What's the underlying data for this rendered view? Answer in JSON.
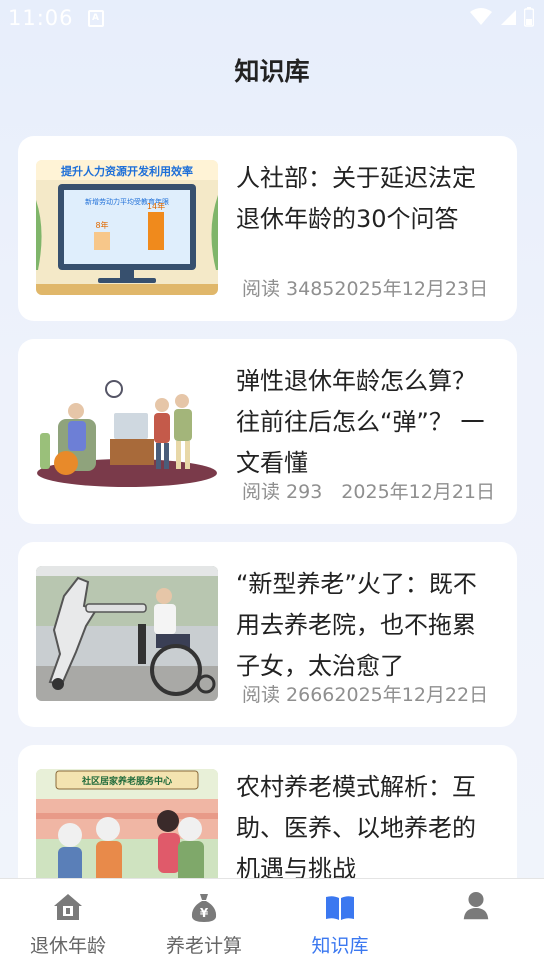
{
  "status_bar": {
    "time": "11:06"
  },
  "header": {
    "title": "知识库"
  },
  "articles": [
    {
      "title": "人社部：关于延迟法定退休年龄的30个问答",
      "meta": "阅读 34852025年12月23日",
      "thumb_icon": "retirement-policy-chart-image",
      "thumb_title": "提升人力资源开发利用效率",
      "thumb_subtitle": "新增劳动力平均受教育年限",
      "thumb_bar1_label": "8年",
      "thumb_bar2_label": "14年"
    },
    {
      "title": "弹性退休年龄怎么算？往前往后怎么“弹”？ 一文看懂",
      "meta": "阅读 293　2025年12月21日",
      "thumb_icon": "elderly-people-illustration"
    },
    {
      "title": "“新型养老”火了：既不用去养老院，也不拖累子女，太治愈了",
      "meta": "阅读 26662025年12月22日",
      "thumb_icon": "robot-wheelchair-photo"
    },
    {
      "title": "农村养老模式解析：互助、医养、以地养老的机遇与挑战",
      "meta": "",
      "thumb_icon": "community-elderly-care-illustration",
      "thumb_sign": "社区居家养老服务中心"
    }
  ],
  "tabbar": {
    "tabs": [
      {
        "label": "退休年龄",
        "icon": "house-icon"
      },
      {
        "label": "养老计算",
        "icon": "money-bag-icon"
      },
      {
        "label": "知识库",
        "icon": "book-icon",
        "active": true
      },
      {
        "label": "",
        "icon": "person-icon"
      }
    ]
  },
  "colors": {
    "accent": "#3b78f0",
    "inactive": "#666666",
    "background": "#eef2fb"
  }
}
